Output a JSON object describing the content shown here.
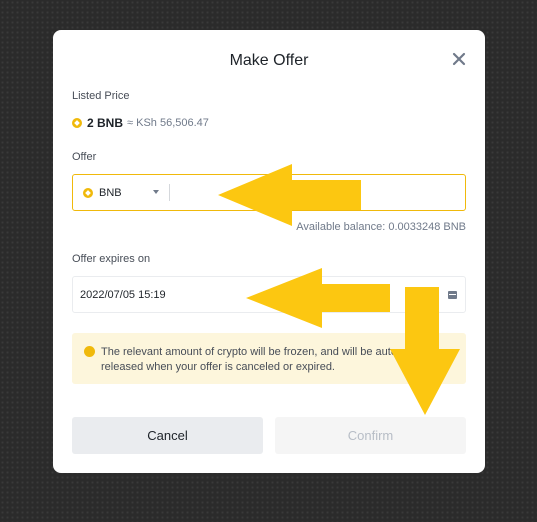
{
  "modal": {
    "title": "Make Offer",
    "listed_price_label": "Listed Price",
    "listed_amount": "2 BNB",
    "listed_fiat": "≈ KSh 56,506.47",
    "offer_label": "Offer",
    "currency": "BNB",
    "offer_value": "",
    "available_balance": "Available balance: 0.0033248 BNB",
    "expires_label": "Offer expires on",
    "expires_value": "2022/07/05 15:19",
    "notice": "The relevant amount of crypto will be frozen, and will be automatically released when your offer is canceled or expired.",
    "cancel_label": "Cancel",
    "confirm_label": "Confirm"
  },
  "colors": {
    "accent": "#f0b90b",
    "annotation_arrow": "#fcc711",
    "notice_bg": "#fdf6dc",
    "backdrop": "#2b2b2b"
  },
  "icons": [
    "close-icon",
    "bnb-coin-icon",
    "chevron-down-icon",
    "calendar-icon",
    "warning-dot-icon",
    "arrow-left-annotation",
    "arrow-down-annotation"
  ]
}
